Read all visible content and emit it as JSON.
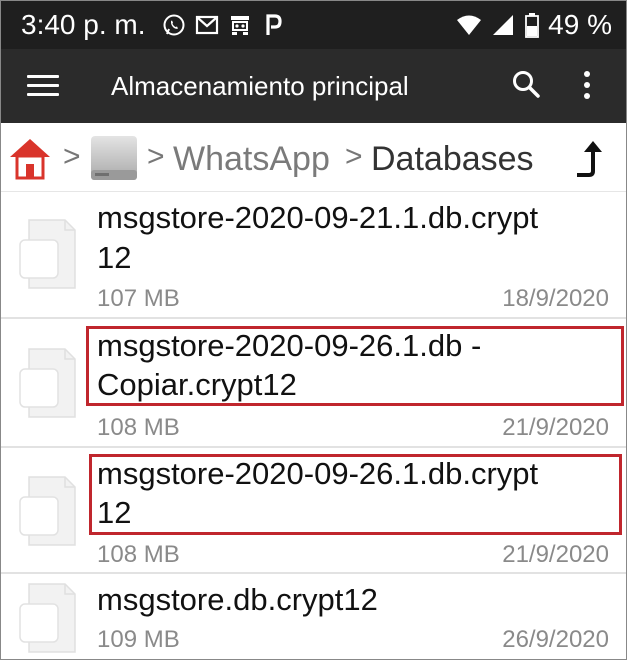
{
  "status": {
    "time": "3:40 p. m.",
    "battery": "49 %",
    "icons": [
      "whatsapp-icon",
      "gmail-icon",
      "robot-icon",
      "p-icon",
      "wifi-icon",
      "signal-icon",
      "battery-icon"
    ]
  },
  "appbar": {
    "title": "Almacenamiento principal",
    "icons": [
      "menu-icon",
      "search-icon",
      "more-vert-icon"
    ]
  },
  "breadcrumb": {
    "items": [
      "WhatsApp",
      "Databases"
    ],
    "separator": ">",
    "icons": [
      "home-icon",
      "storage-icon",
      "up-arrow-icon"
    ]
  },
  "files": [
    {
      "name_line1": "msgstore-2020-09-21.1.db.crypt",
      "name_line2": "12",
      "size": "107 MB",
      "date": "18/9/2020"
    },
    {
      "name_line1": "msgstore-2020-09-26.1.db -",
      "name_line2": "Copiar.crypt12",
      "size": "108 MB",
      "date": "21/9/2020"
    },
    {
      "name_line1": "msgstore-2020-09-26.1.db.crypt",
      "name_line2": "12",
      "size": "108 MB",
      "date": "21/9/2020"
    },
    {
      "name_line1": "msgstore.db.crypt12",
      "name_line2": "",
      "size": "109 MB",
      "date": "26/9/2020"
    }
  ],
  "colors": {
    "statusbar": "#1f1f1f",
    "appbar": "#2b2b2b",
    "highlight": "#c0262d",
    "home": "#d9342b"
  }
}
